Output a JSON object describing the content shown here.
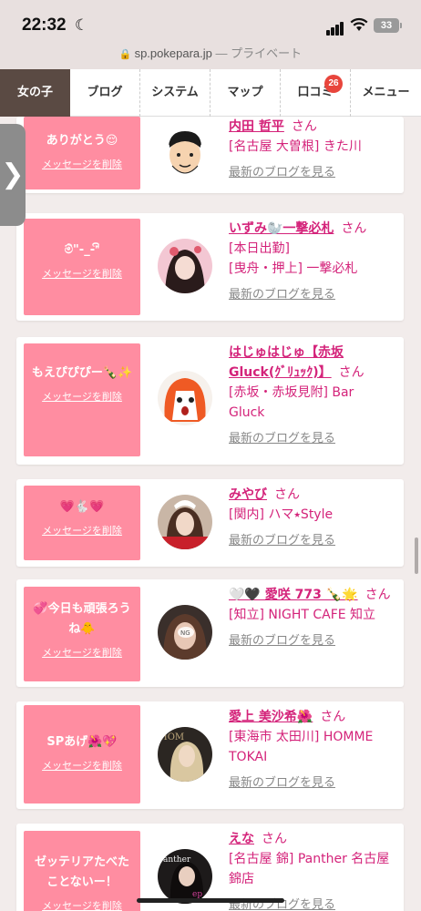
{
  "status": {
    "time": "22:32",
    "battery": "33"
  },
  "url_bar": {
    "domain": "sp.pokepara.jp",
    "sep": "—",
    "mode": "プライベート"
  },
  "nav": {
    "items": [
      {
        "label": "女の子",
        "active": true
      },
      {
        "label": "ブログ"
      },
      {
        "label": "システム"
      },
      {
        "label": "マップ"
      },
      {
        "label": "口コミ",
        "badge": "26"
      },
      {
        "label": "メニュー"
      }
    ]
  },
  "side_tab": {
    "label": "❯"
  },
  "delete_label": "メッセージを削除",
  "san_label": "さん",
  "blog_label": "最新のブログを見る",
  "cards": [
    {
      "message": "ありがとう😌",
      "name": "内田 哲平",
      "shop": [
        "[名古屋 大曽根] きた川"
      ]
    },
    {
      "message": "ම්\"-_-\"ි",
      "name": "いずみ🦭一撃必札",
      "shop": [
        "[本日出勤]",
        "[曳舟・押上] 一撃必札"
      ]
    },
    {
      "message": "もえぴぴぴー🍾✨",
      "name": "はじゅはじゅ【赤坂Gluck(ｸﾞﾘｭｯｸ)】",
      "shop": [
        "[赤坂・赤坂見附] Bar",
        "Gluck"
      ]
    },
    {
      "message": "💗🐇💗",
      "name": "みやび",
      "shop": [
        "[関内] ハマ⭑Style"
      ]
    },
    {
      "message": "💞今日も頑張ろうね🐥",
      "name": "🤍🖤 愛咲 773 🍾🌟",
      "shop": [
        "[知立] NIGHT CAFE 知立"
      ]
    },
    {
      "message": "SPあげ🌺💖",
      "name": "愛上 美沙希🌺",
      "shop": [
        "[東海市 太田川] HOMME",
        "TOKAI"
      ]
    },
    {
      "message": "ゼッテリアたべたことないー！",
      "name": "えな",
      "shop": [
        "[名古屋 錦] Panther 名古屋",
        "錦店"
      ]
    }
  ],
  "colors": {
    "accent": "#d4237a",
    "message_bg": "#ff8da1",
    "nav_active": "#5a4a43"
  }
}
